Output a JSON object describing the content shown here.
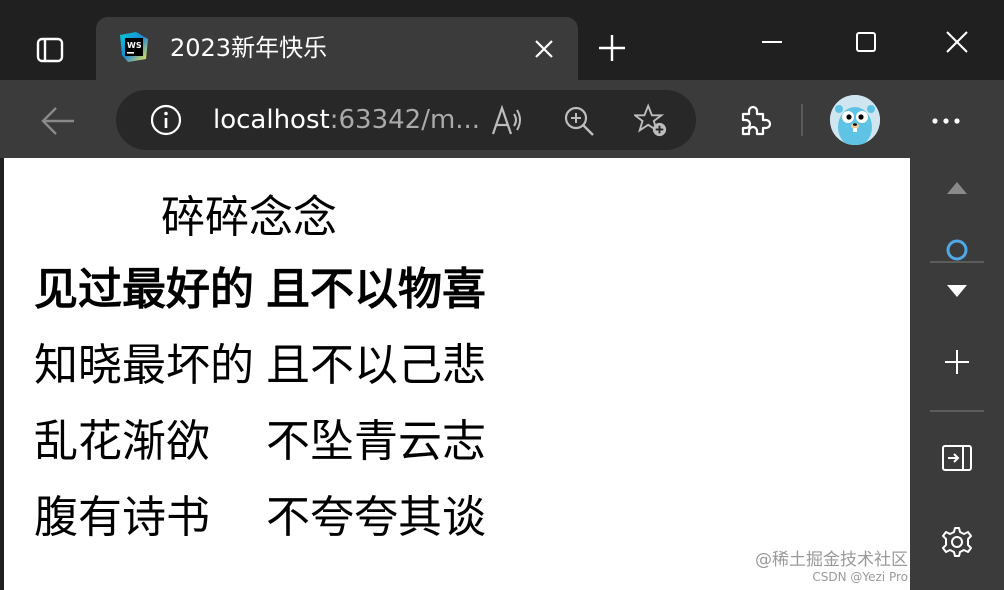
{
  "tab": {
    "title": "2023新年快乐",
    "favicon": "webstorm-icon"
  },
  "address": {
    "host": "localhost",
    "rest": ":63342/m..."
  },
  "content": {
    "caption": "碎碎念念",
    "header_row": [
      "见过最好的",
      "且不以物喜"
    ],
    "rows": [
      [
        "知晓最坏的",
        "且不以己悲"
      ],
      [
        "乱花渐欲",
        "不坠青云志"
      ],
      [
        "腹有诗书",
        "不夸夸其谈"
      ]
    ]
  },
  "watermark": {
    "line1": "@稀土掘金技术社区",
    "line2": "CSDN @Yezi Pro"
  },
  "colors": {
    "titlebar": "#202020",
    "toolbar": "#3b3b3b",
    "address_bar": "#282828",
    "content_bg": "#ffffff"
  }
}
